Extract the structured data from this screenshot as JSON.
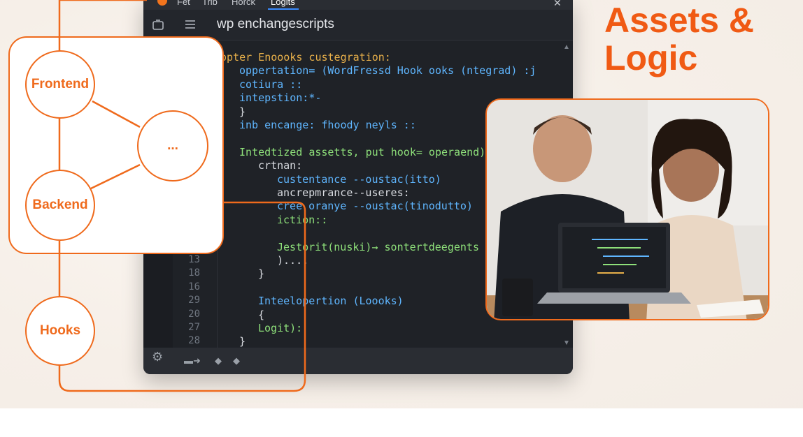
{
  "heading": {
    "line1": "Assets &",
    "line2": "Logic"
  },
  "editor": {
    "tabs": [
      "Fet",
      "Trib",
      "Horck",
      "Logits"
    ],
    "title": "wp enchangescripts",
    "code_lines": [
      {
        "text": "opter Enoooks custegration:",
        "color": "#e8b04a",
        "indent": 0
      },
      {
        "text": "oppertation= (WordFressd Hook ooks (ntegrad) :j",
        "color": "#5fb6ff",
        "indent": 1
      },
      {
        "text": "cotiura ::",
        "color": "#5fb6ff",
        "indent": 1
      },
      {
        "text": "intepstion:*-",
        "color": "#5fb6ff",
        "indent": 1
      },
      {
        "text": "}",
        "color": "#d8dbe0",
        "indent": 1
      },
      {
        "text": "inb encange: fhoody neyls ::",
        "color": "#5fb6ff",
        "indent": 1
      },
      {
        "text": "",
        "color": "#d8dbe0",
        "indent": 0
      },
      {
        "text": "Intedtized assetts, put hook= operaend),",
        "color": "#8ee07a",
        "indent": 1
      },
      {
        "text": "crtnan:",
        "color": "#d8dbe0",
        "indent": 2
      },
      {
        "text": "custentance --oustac(itto)",
        "color": "#5fb6ff",
        "indent": 3
      },
      {
        "text": "ancrepmrance--useres:",
        "color": "#d8dbe0",
        "indent": 3
      },
      {
        "text": "cree oranye --oustac(tinodutto)",
        "color": "#5fb6ff",
        "indent": 3
      },
      {
        "text": "iction::",
        "color": "#8ee07a",
        "indent": 3
      },
      {
        "text": "",
        "color": "#d8dbe0",
        "indent": 0
      },
      {
        "text": "Jestorit(nuski)→ sontertdeegents",
        "color": "#8ee07a",
        "indent": 3
      },
      {
        "text": ")....",
        "color": "#d8dbe0",
        "indent": 3
      },
      {
        "text": "}",
        "color": "#d8dbe0",
        "indent": 2
      },
      {
        "text": "",
        "color": "#d8dbe0",
        "indent": 0
      },
      {
        "text": "Inteelopertion (Loooks)",
        "color": "#5fb6ff",
        "indent": 2
      },
      {
        "text": "{",
        "color": "#d8dbe0",
        "indent": 2
      },
      {
        "text": "Logit):",
        "color": "#8ee07a",
        "indent": 2
      },
      {
        "text": "}",
        "color": "#d8dbe0",
        "indent": 1
      }
    ],
    "line_numbers": [
      {
        "n": "13",
        "row": 15
      },
      {
        "n": "18",
        "row": 16
      },
      {
        "n": "16",
        "row": 17
      },
      {
        "n": "29",
        "row": 18
      },
      {
        "n": "20",
        "row": 19
      },
      {
        "n": "27",
        "row": 20
      },
      {
        "n": "28",
        "row": 21
      }
    ]
  },
  "diagram": {
    "nodes": [
      "Frontend",
      "...",
      "Backend",
      "Hooks"
    ]
  },
  "icons": {
    "toolbar": [
      "window-icon",
      "menu-icon"
    ],
    "accent": "#ef6a1c"
  }
}
